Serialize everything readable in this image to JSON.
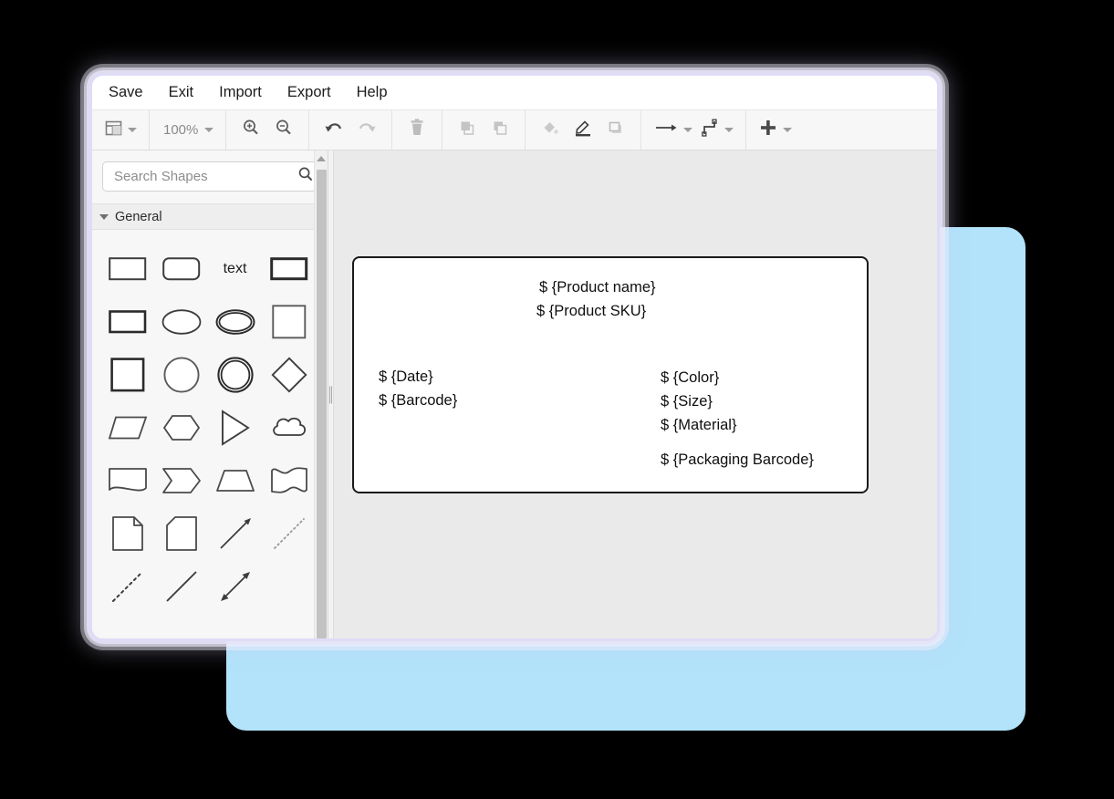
{
  "window": {
    "menu": [
      {
        "label": "Save",
        "name": "menu-save"
      },
      {
        "label": "Exit",
        "name": "menu-exit"
      },
      {
        "label": "Import",
        "name": "menu-import"
      },
      {
        "label": "Export",
        "name": "menu-export"
      },
      {
        "label": "Help",
        "name": "menu-help"
      }
    ]
  },
  "toolbar": {
    "view_icon": "layout-panels-icon",
    "zoom_level": "100%",
    "zoom_in_icon": "zoom-in-icon",
    "zoom_out_icon": "zoom-out-icon",
    "undo_icon": "undo-icon",
    "redo_icon": "redo-icon",
    "delete_icon": "trash-icon",
    "to_front_icon": "bring-to-front-icon",
    "to_back_icon": "send-to-back-icon",
    "fill_icon": "fill-color-icon",
    "line_icon": "line-color-icon",
    "shadow_icon": "shadow-icon",
    "connection_icon": "connection-arrow-icon",
    "waypoint_icon": "waypoint-icon",
    "add_icon": "plus-icon"
  },
  "sidebar": {
    "search": {
      "placeholder": "Search Shapes",
      "value": "",
      "icon": "search-icon"
    },
    "section": {
      "title": "General",
      "expanded": true,
      "caret_icon": "chevron-down-icon"
    },
    "shapes": [
      [
        {
          "name": "shape-rectangle",
          "glyph": "rect"
        },
        {
          "name": "shape-rounded-rectangle",
          "glyph": "rounded-rect"
        },
        {
          "name": "shape-text",
          "glyph": "text",
          "label": "text"
        },
        {
          "name": "shape-textbox",
          "glyph": "thick-rect"
        }
      ],
      [
        {
          "name": "shape-rectangle-thick",
          "glyph": "rect-thick"
        },
        {
          "name": "shape-ellipse",
          "glyph": "ellipse"
        },
        {
          "name": "shape-double-ellipse",
          "glyph": "double-ellipse"
        },
        {
          "name": "shape-square",
          "glyph": "square"
        }
      ],
      [
        {
          "name": "shape-square-thick",
          "glyph": "square-thick"
        },
        {
          "name": "shape-circle",
          "glyph": "circle"
        },
        {
          "name": "shape-double-circle",
          "glyph": "double-circle"
        },
        {
          "name": "shape-diamond",
          "glyph": "diamond"
        }
      ],
      [
        {
          "name": "shape-parallelogram",
          "glyph": "parallelogram"
        },
        {
          "name": "shape-hexagon",
          "glyph": "hexagon"
        },
        {
          "name": "shape-triangle",
          "glyph": "triangle"
        },
        {
          "name": "shape-cloud",
          "glyph": "cloud"
        }
      ],
      [
        {
          "name": "shape-document",
          "glyph": "document"
        },
        {
          "name": "shape-step",
          "glyph": "step"
        },
        {
          "name": "shape-trapezoid",
          "glyph": "trapezoid"
        },
        {
          "name": "shape-tape",
          "glyph": "tape"
        }
      ],
      [
        {
          "name": "shape-note",
          "glyph": "note"
        },
        {
          "name": "shape-card",
          "glyph": "card"
        },
        {
          "name": "shape-arrow-line",
          "glyph": "arrow-line"
        },
        {
          "name": "shape-dotted-line",
          "glyph": "dotted-line"
        }
      ],
      [
        {
          "name": "shape-dashed-line",
          "glyph": "dashed-line"
        },
        {
          "name": "shape-plain-line",
          "glyph": "plain-line"
        },
        {
          "name": "shape-bidirectional-arrow",
          "glyph": "bidirectional-arrow"
        }
      ]
    ],
    "scrollbar": {
      "up_arrow_icon": "scroll-up-arrow-icon"
    }
  },
  "canvas": {
    "splitter_icon": "vertical-splitter-handle",
    "label_shape": {
      "name": "product-label-shape",
      "texts": {
        "product_name": "$ {Product name}",
        "product_sku": "$ {Product SKU}",
        "date": "$ {Date}",
        "barcode": "$ {Barcode}",
        "color": "$ {Color}",
        "size": "$ {Size}",
        "material": "$ {Material}",
        "packaging_barcode": "$ {Packaging Barcode}"
      }
    }
  },
  "colors": {
    "page_background": "#000000",
    "accent_card": "#b2e3fb",
    "window_glow": "#dddbf5",
    "canvas_background": "#eaeaea",
    "panel_background": "#f7f7f7",
    "shape_border": "#1a1a1a"
  }
}
